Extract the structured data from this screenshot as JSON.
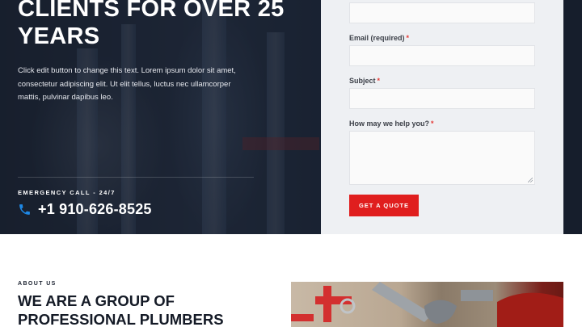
{
  "hero": {
    "title": "CLIENTS FOR OVER 25 YEARS",
    "body": "Click edit button to change this text. Lorem ipsum dolor sit amet, consectetur adipiscing elit. Ut elit tellus, luctus nec ullamcorper mattis, pulvinar dapibus leo.",
    "emergency_label": "EMERGENCY CALL - 24/7",
    "phone": "+1 910-626-8525",
    "phone_icon": "phone-icon",
    "accent_color": "#1e88e5"
  },
  "form": {
    "required_mark": "*",
    "fields": [
      {
        "label": "Email (required)",
        "value": ""
      },
      {
        "label": "Subject",
        "value": ""
      },
      {
        "label": "How may we help you?",
        "value": ""
      }
    ],
    "submit_label": "GET A QUOTE",
    "button_color": "#e01e1e"
  },
  "about": {
    "eyebrow": "ABOUT US",
    "heading": "WE ARE A GROUP OF PROFESSIONAL PLUMBERS",
    "image_alt": "plumbing tools"
  }
}
